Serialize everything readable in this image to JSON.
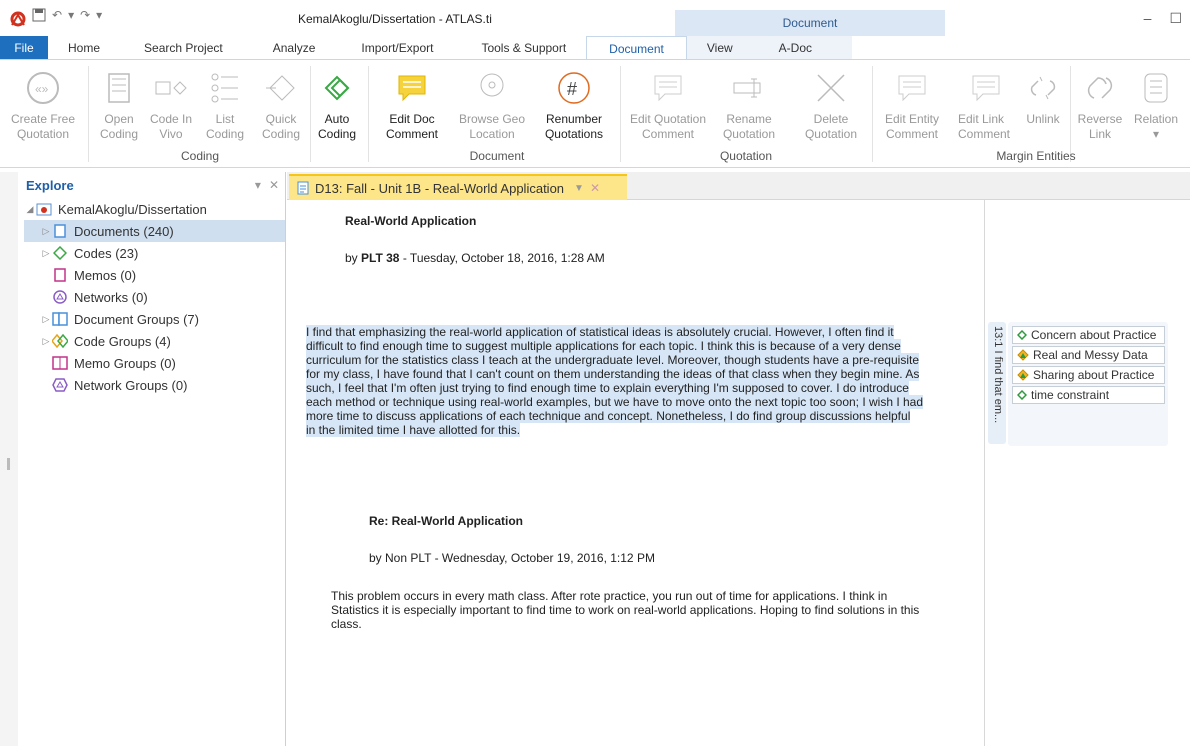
{
  "titlebar": {
    "window_title": "KemalAkoglu/Dissertation - ATLAS.ti",
    "context_tab_header": "Document",
    "minimize": "–",
    "maximize": "☐"
  },
  "tabs": [
    {
      "label": "File"
    },
    {
      "label": "Home"
    },
    {
      "label": "Search Project"
    },
    {
      "label": "Analyze"
    },
    {
      "label": "Import/Export"
    },
    {
      "label": "Tools & Support"
    },
    {
      "label": "Document"
    },
    {
      "label": "View"
    },
    {
      "label": "A-Doc"
    }
  ],
  "ribbon": {
    "create_free_quotation": "Create Free\nQuotation",
    "open_coding": "Open\nCoding",
    "code_in_vivo": "Code In\nVivo",
    "list_coding": "List\nCoding",
    "quick_coding": "Quick\nCoding",
    "auto_coding": "Auto\nCoding",
    "edit_doc_comment": "Edit Doc\nComment",
    "browse_geo_location": "Browse Geo\nLocation",
    "renumber_quotations": "Renumber\nQuotations",
    "edit_quotation_comment": "Edit Quotation\nComment",
    "rename_quotation": "Rename\nQuotation",
    "delete_quotation": "Delete\nQuotation",
    "edit_entity_comment": "Edit Entity\nComment",
    "edit_link_comment": "Edit Link\nComment",
    "unlink": "Unlink",
    "reverse_link": "Reverse\nLink",
    "relation": "Relation\n▾",
    "group_coding": "Coding",
    "group_document": "Document",
    "group_quotation": "Quotation",
    "group_margin_entities": "Margin Entities"
  },
  "explore": {
    "title": "Explore",
    "root": "KemalAkoglu/Dissertation",
    "items": [
      {
        "label": "Documents (240)"
      },
      {
        "label": "Codes (23)"
      },
      {
        "label": "Memos (0)"
      },
      {
        "label": "Networks (0)"
      },
      {
        "label": "Document Groups (7)"
      },
      {
        "label": "Code Groups (4)"
      },
      {
        "label": "Memo Groups (0)"
      },
      {
        "label": "Network Groups (0)"
      }
    ]
  },
  "document": {
    "tab_title": "D13: Fall - Unit 1B - Real-World Application",
    "post1_title": "Real-World Application",
    "post1_by": "by ",
    "post1_author": "PLT 38",
    "post1_date": " - Tuesday, October 18, 2016, 1:28 AM",
    "post1_lines": [
      "I find that emphasizing the real-world application of statistical ideas is absolutely crucial.  However, I often find it",
      "difficult to find enough time to suggest multiple applications for each topic.  I think this is because of a very dense",
      "curriculum for the statistics class I teach at the undergraduate level.  Moreover, though students have a pre-requisite",
      "for my class, I have found that I can't count on them understanding the ideas of that class when they begin mine.  As",
      "such, I feel that I'm often just trying to find enough time to explain everything I'm supposed to cover.  I do introduce",
      "each method or technique using real-world examples, but we have to move onto the next topic too soon; I wish I had",
      "more time to discuss applications of each technique and concept.  Nonetheless, I do find group discussions helpful",
      "in the limited time I have allotted for this."
    ],
    "post2_title": "Re: Real-World Application",
    "post2_byline": "by Non PLT - Wednesday, October 19, 2016, 1:12 PM",
    "post2_lines": [
      "This problem occurs in every math class. After rote practice, you run out of time for applications.  I think in",
      "Statistics it is especially important to find time to work on real-world applications.  Hoping to find solutions in this",
      "class."
    ]
  },
  "margin": {
    "quotation_label": "13:1 I find that em...",
    "codes": [
      {
        "label": "Concern about Practice",
        "color": "#2e9a3e"
      },
      {
        "label": "Real and Messy Data",
        "color": "#e8a317"
      },
      {
        "label": "Sharing about Practice",
        "color": "#e8a317"
      },
      {
        "label": "time constraint",
        "color": "#2e9a3e"
      }
    ]
  }
}
